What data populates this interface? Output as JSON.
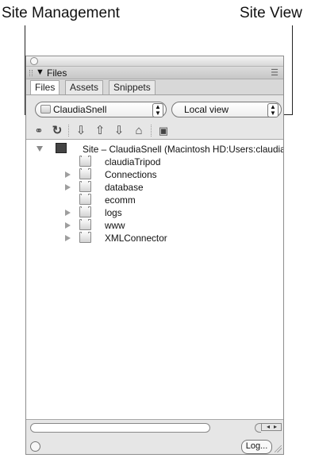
{
  "callouts": {
    "left": "Site Management",
    "right": "Site View"
  },
  "panel": {
    "title": "Files",
    "tabs": [
      "Files",
      "Assets",
      "Snippets"
    ],
    "site_selector": "ClaudiaSnell",
    "view_selector": "Local view",
    "toolbar_icons": [
      "connect-icon",
      "refresh-icon",
      "get-files-icon",
      "put-files-icon",
      "check-in-out-icon",
      "synchronize-icon",
      "expand-collapse-icon"
    ],
    "tree": {
      "root": "Site – ClaudiaSnell (Macintosh HD:Users:claudia",
      "items": [
        "claudiaTripod",
        "Connections",
        "database",
        "ecomm",
        "logs",
        "www",
        "XMLConnector"
      ]
    },
    "log_button": "Log..."
  }
}
